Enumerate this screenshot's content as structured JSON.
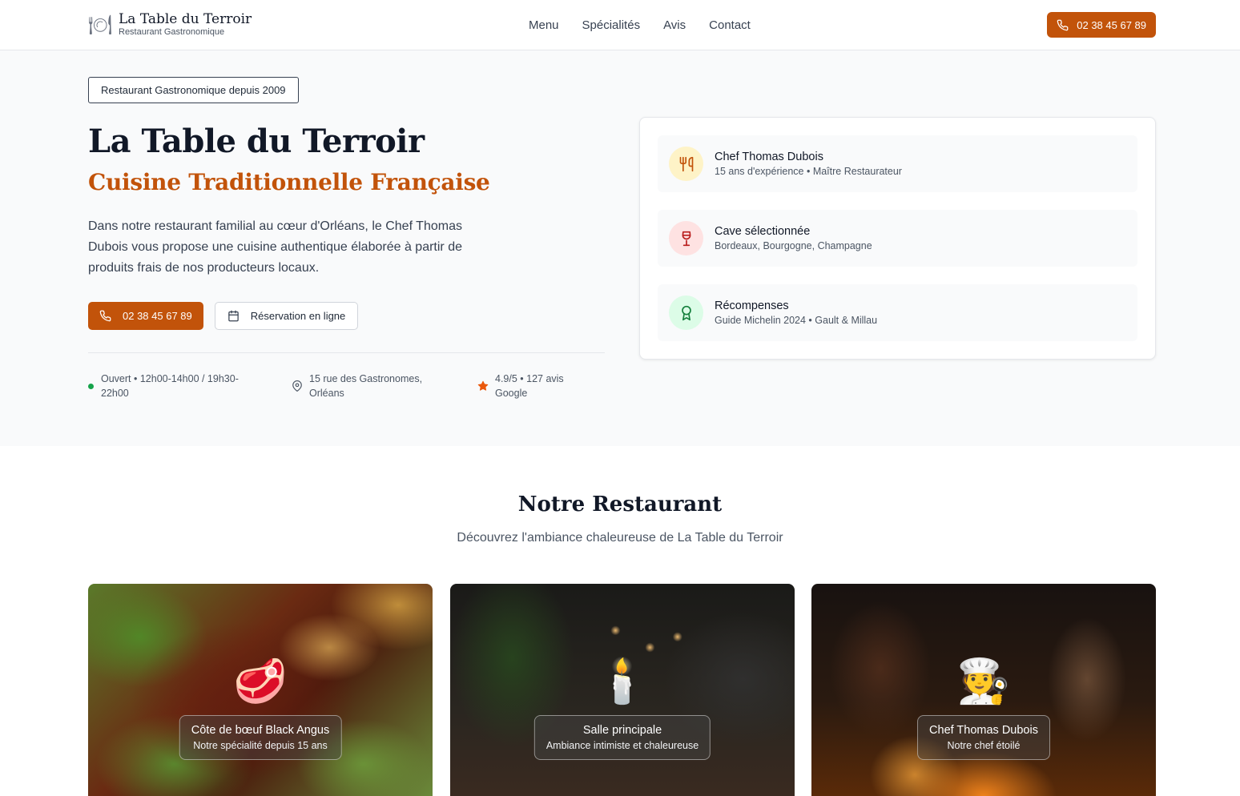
{
  "header": {
    "brand_icon": "🍽",
    "brand_title": "La Table du Terroir",
    "brand_subtitle": "Restaurant Gastronomique",
    "nav": [
      "Menu",
      "Spécialités",
      "Avis",
      "Contact"
    ],
    "phone": "02 38 45 67 89"
  },
  "hero": {
    "tag": "Restaurant Gastronomique depuis 2009",
    "title": "La Table du Terroir",
    "subtitle": "Cuisine Traditionnelle Française",
    "description": "Dans notre restaurant familial au cœur d'Orléans, le Chef Thomas Dubois vous propose une cuisine authentique élaborée à partir de produits frais de nos producteurs locaux.",
    "phone_button": "02 38 45 67 89",
    "booking_button": "Réservation en ligne",
    "hours": "Ouvert • 12h00-14h00 / 19h30-22h00",
    "address": "15 rue des Gastronomes, Orléans",
    "rating": "4.9/5 • 127 avis Google"
  },
  "features": [
    {
      "title": "Chef Thomas Dubois",
      "desc": "15 ans d'expérience • Maître Restaurateur",
      "icon": "utensils-icon",
      "bg": "#fef3c7",
      "color": "#c2530a"
    },
    {
      "title": "Cave sélectionnée",
      "desc": "Bordeaux, Bourgogne, Champagne",
      "icon": "wine-icon",
      "bg": "#fee2e2",
      "color": "#b91c1c"
    },
    {
      "title": "Récompenses",
      "desc": "Guide Michelin 2024 • Gault & Millau",
      "icon": "award-icon",
      "bg": "#dcfce7",
      "color": "#15803d"
    }
  ],
  "restaurant": {
    "title": "Notre Restaurant",
    "subtitle": "Découvrez l'ambiance chaleureuse de La Table du Terroir",
    "photos": [
      {
        "emoji": "🥩",
        "title": "Côte de bœuf Black Angus",
        "sub": "Notre spécialité depuis 15 ans"
      },
      {
        "emoji": "🕯️",
        "title": "Salle principale",
        "sub": "Ambiance intimiste et chaleureuse"
      },
      {
        "emoji": "🧑‍🍳",
        "title": "Chef Thomas Dubois",
        "sub": "Notre chef étoilé"
      }
    ]
  },
  "colors": {
    "accent": "#c2530a",
    "open_dot": "#16a34a",
    "star": "#ea580c"
  }
}
